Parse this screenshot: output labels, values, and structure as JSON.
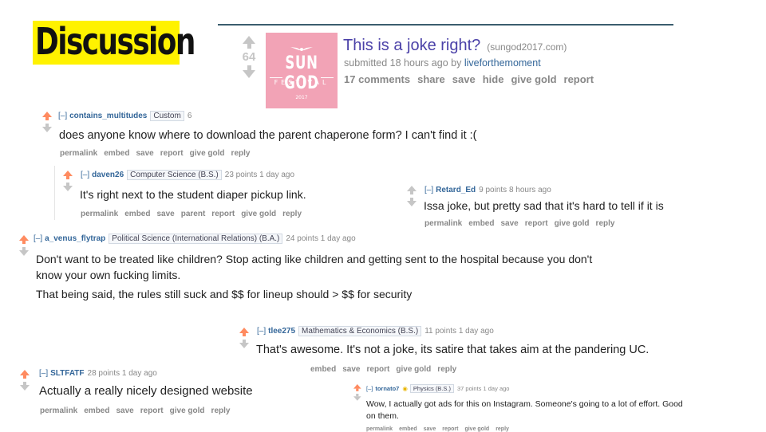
{
  "slide_title": "Discussion",
  "post": {
    "score": "64",
    "thumbnail": {
      "line1": "SUN GOD",
      "line2": "FESTIVAL",
      "line3": "2017"
    },
    "title": "This is a joke right?",
    "domain": "(sungod2017.com)",
    "submitted_prefix": "submitted 18 hours ago by",
    "author": "liveforthemoment",
    "links": [
      "17 comments",
      "share",
      "save",
      "hide",
      "give gold",
      "report"
    ]
  },
  "comments": {
    "c1": {
      "expand": "[–]",
      "author": "contains_multitudes",
      "flair": "Custom",
      "meta": "6",
      "body": "does anyone know where to download the parent chaperone form? I can't find it :(",
      "links": [
        "permalink",
        "embed",
        "save",
        "report",
        "give gold",
        "reply"
      ]
    },
    "c2": {
      "expand": "[–]",
      "author": "daven26",
      "flair": "Computer Science (B.S.)",
      "meta": "23 points 1 day ago",
      "body": "It's right next to the student diaper pickup link.",
      "links": [
        "permalink",
        "embed",
        "save",
        "parent",
        "report",
        "give gold",
        "reply"
      ]
    },
    "c3": {
      "expand": "[–]",
      "author": "Retard_Ed",
      "meta": "9 points 8 hours ago",
      "body": "Issa joke, but pretty sad that it's hard to tell if it is",
      "links": [
        "permalink",
        "embed",
        "save",
        "report",
        "give gold",
        "reply"
      ]
    },
    "c4": {
      "expand": "[–]",
      "author": "a_venus_flytrap",
      "flair": "Political Science (International Relations) (B.A.)",
      "meta": "24 points 1 day ago",
      "body1": "Don't want to be treated like children? Stop acting like children and getting sent to the hospital because you don't",
      "body2": "know your own fucking limits.",
      "body3": "That being said, the rules still suck and $$ for lineup should > $$ for security"
    },
    "c5": {
      "expand": "[–]",
      "author": "tlee275",
      "flair": "Mathematics & Economics (B.S.)",
      "meta": "11 points 1 day ago",
      "body": "That's awesome. It's not a joke, its satire that takes aim at the pandering UC.",
      "links": [
        "embed",
        "save",
        "report",
        "give gold",
        "reply"
      ]
    },
    "c6": {
      "expand": "[–]",
      "author": "SLTFATF",
      "meta": "28 points 1 day ago",
      "body": "Actually a really nicely designed website",
      "links": [
        "permalink",
        "embed",
        "save",
        "report",
        "give gold",
        "reply"
      ]
    },
    "c7": {
      "expand": "[–]",
      "author": "tornato7",
      "flair": "Physics (B.S.)",
      "meta": "37 points 1 day ago",
      "body1": "Wow, I actually got ads for this on Instagram. Someone's going to a lot of effort. Good",
      "body2": "on them.",
      "links": [
        "permalink",
        "embed",
        "save",
        "report",
        "give gold",
        "reply"
      ]
    }
  },
  "colors": {
    "highlight": "#fff200",
    "upvote": "#ff8b60",
    "link_blue": "#336699",
    "title_purple": "#4b41a8",
    "thumb_pink": "#f2a3b6"
  }
}
